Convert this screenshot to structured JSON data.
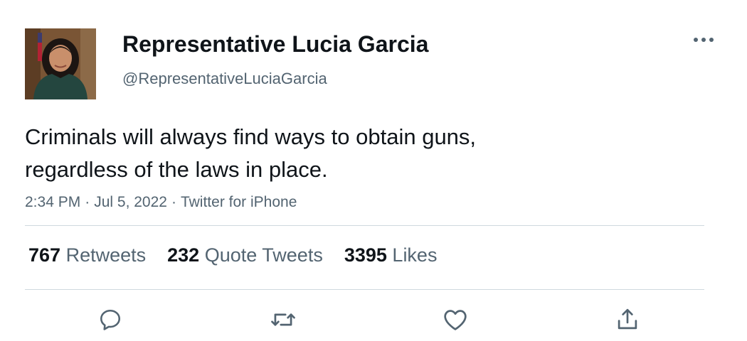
{
  "author": {
    "display_name": "Representative Lucia Garcia",
    "handle": "@RepresentativeLuciaGarcia",
    "avatar_icon": "profile-photo"
  },
  "tweet": {
    "text_lines": [
      "Criminals will always find ways to obtain guns,",
      "regardless of the laws in place."
    ],
    "time": "2:34 PM",
    "date": "Jul 5, 2022",
    "source": "Twitter for iPhone",
    "separator": "·"
  },
  "stats": {
    "retweets": {
      "count": "767",
      "label": "Retweets"
    },
    "quote_tweets": {
      "count": "232",
      "label": "Quote Tweets"
    },
    "likes": {
      "count": "3395",
      "label": "Likes"
    }
  },
  "actions": {
    "reply_icon": "reply-icon",
    "retweet_icon": "retweet-icon",
    "like_icon": "heart-icon",
    "share_icon": "share-icon",
    "more_icon": "more-icon"
  },
  "colors": {
    "text_primary": "#0f1419",
    "text_secondary": "#536471",
    "divider": "#cfd9de",
    "icon": "#536471"
  }
}
